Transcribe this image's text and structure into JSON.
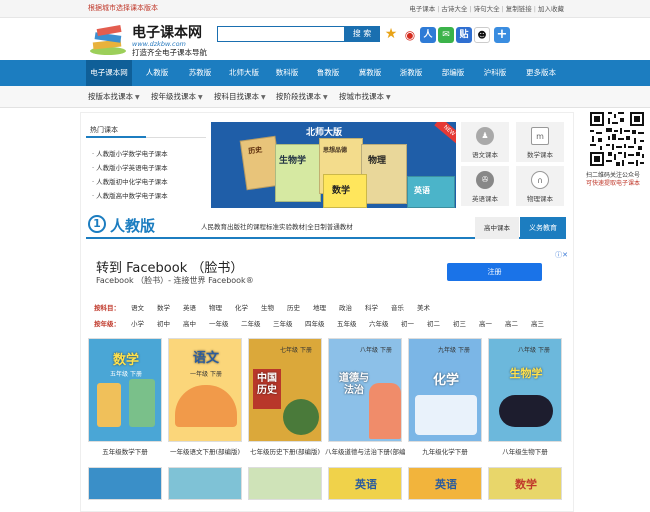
{
  "topbar": {
    "left_text": "根据城市选择课本版本",
    "links": [
      "电子课本",
      "古诗大全",
      "诗句大全",
      "复制链接",
      "加入收藏"
    ]
  },
  "header": {
    "logo_name": "电子课本网",
    "logo_url": "www.dzkbw.com",
    "logo_slogan": "打造齐全电子课本导航",
    "search_placeholder": "",
    "search_button": "搜 索",
    "social_icons": [
      "star-icon",
      "weibo-icon",
      "renren-icon",
      "wechat-icon",
      "tieba-icon",
      "qq-icon",
      "plus-icon"
    ]
  },
  "nav": {
    "items": [
      "电子课本网",
      "人教版",
      "苏教版",
      "北师大版",
      "数科版",
      "鲁教版",
      "冀教版",
      "浙教版",
      "部编版",
      "沪科版",
      "更多版本"
    ],
    "active_index": 0
  },
  "subnav": {
    "items": [
      "按版本找课本",
      "按年级找课本",
      "按科目找课本",
      "按阶段找课本",
      "按城市找课本"
    ]
  },
  "hot": {
    "title": "热门课本",
    "items": [
      "人教版小学数学电子课本",
      "人教版小学英语电子课本",
      "人教版初中化学电子课本",
      "人教版高中数学电子课本"
    ]
  },
  "banner": {
    "title": "北师大版",
    "badge": "NEW",
    "book_titles": [
      "历史",
      "生物学",
      "思想品德",
      "物理",
      "数学",
      "英语"
    ]
  },
  "tiles": [
    {
      "label": "语文课本",
      "icon": "person-icon"
    },
    {
      "label": "数学课本",
      "icon": "formula-icon"
    },
    {
      "label": "英语课本",
      "icon": "film-icon"
    },
    {
      "label": "物理课本",
      "icon": "magnet-icon"
    }
  ],
  "qr": {
    "caption": "扫二维码关注公众号",
    "caption2": "可快速提取电子课本"
  },
  "section": {
    "number": "1",
    "heading": "人教版",
    "description": "人民教育出版社的课程标准实验教材|全日制普通教材",
    "tab_high": "高中课本",
    "tab_compulsory": "义务教育"
  },
  "ad": {
    "title": "转到 Facebook （脸书）",
    "subtitle": "Facebook （脸书）- 连接世界 Facebook®",
    "button": "注册"
  },
  "filters": {
    "subject_label": "按科目：",
    "subjects": [
      "语文",
      "数学",
      "英语",
      "物理",
      "化学",
      "生物",
      "历史",
      "地理",
      "政治",
      "科学",
      "音乐",
      "美术"
    ],
    "grade_label": "按年级：",
    "grades": [
      "小学",
      "初中",
      "高中",
      "一年级",
      "二年级",
      "三年级",
      "四年级",
      "五年级",
      "六年级",
      "初一",
      "初二",
      "初三",
      "高一",
      "高二",
      "高三"
    ]
  },
  "books": [
    {
      "title": "数学",
      "sub": "五年级 下册",
      "caption": "五年级数学下册",
      "color": "#4aa6d6"
    },
    {
      "title": "语文",
      "sub": "一年级 下册",
      "caption": "一年级语文下册(部编版)",
      "color": "#e98a3c"
    },
    {
      "title": "中国历史",
      "sub": "七年级 下册",
      "caption": "七年级历史下册(部编版)",
      "color": "#e0b43a"
    },
    {
      "title": "道德与法治",
      "sub": "八年级 下册",
      "caption": "八年级道德与法治下册(部编版)",
      "color": "#8cc0e8"
    },
    {
      "title": "化学",
      "sub": "九年级 下册",
      "caption": "九年级化学下册",
      "color": "#7bb6e6"
    },
    {
      "title": "生物学",
      "sub": "八年级 下册",
      "caption": "八年级生物下册",
      "color": "#6cb8dc"
    }
  ],
  "books_row2": [
    {
      "title": "",
      "sub": "",
      "color": "#3a8fc8"
    },
    {
      "title": "",
      "sub": "",
      "color": "#7fc2d6"
    },
    {
      "title": "",
      "sub": "",
      "color": "#cfe3b8"
    },
    {
      "title": "英语",
      "sub": "",
      "color": "#f0d24a"
    },
    {
      "title": "英语",
      "sub": "",
      "color": "#f2b43c"
    },
    {
      "title": "数学",
      "sub": "",
      "color": "#e8d66a"
    }
  ]
}
